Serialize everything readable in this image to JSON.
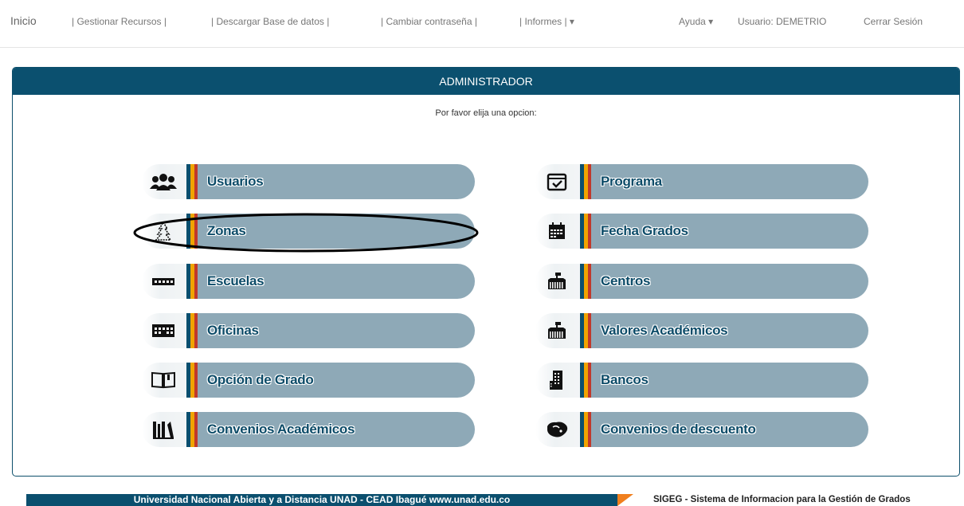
{
  "nav": {
    "brand": "Inicio",
    "items": [
      "| Gestionar Recursos |",
      "| Descargar Base de datos |",
      "| Cambiar contraseña |",
      "| Informes | ▾"
    ],
    "help": "Ayuda ▾",
    "user": "Usuario: DEMETRIO",
    "logout": "Cerrar Sesión"
  },
  "panel": {
    "title": "ADMINISTRADOR",
    "prompt": "Por favor elija una opcion:"
  },
  "menu": {
    "left": [
      {
        "label": "Usuarios",
        "icon": "users-icon"
      },
      {
        "label": "Zonas",
        "icon": "tree-icon"
      },
      {
        "label": "Escuelas",
        "icon": "school-icon"
      },
      {
        "label": "Oficinas",
        "icon": "office-icon"
      },
      {
        "label": "Opción de Grado",
        "icon": "book-icon"
      },
      {
        "label": "Convenios Académicos",
        "icon": "library-icon"
      }
    ],
    "right": [
      {
        "label": "Programa",
        "icon": "calendar-check-icon"
      },
      {
        "label": "Fecha Grados",
        "icon": "calendar-icon"
      },
      {
        "label": "Centros",
        "icon": "building-icon"
      },
      {
        "label": "Valores Académicos",
        "icon": "building-icon"
      },
      {
        "label": "Bancos",
        "icon": "bank-building-icon"
      },
      {
        "label": "Convenios de descuento",
        "icon": "handshake-icon"
      }
    ]
  },
  "colors": {
    "primary": "#0b506f",
    "pill": "#8ea9b7",
    "accent_orange": "#f0a400",
    "accent_red": "#c0392b"
  },
  "footer": {
    "left": "Universidad Nacional Abierta y a Distancia UNAD - CEAD Ibagué  www.unad.edu.co",
    "right": "SIGEG - Sistema de Informacion para la Gestión de Grados"
  }
}
